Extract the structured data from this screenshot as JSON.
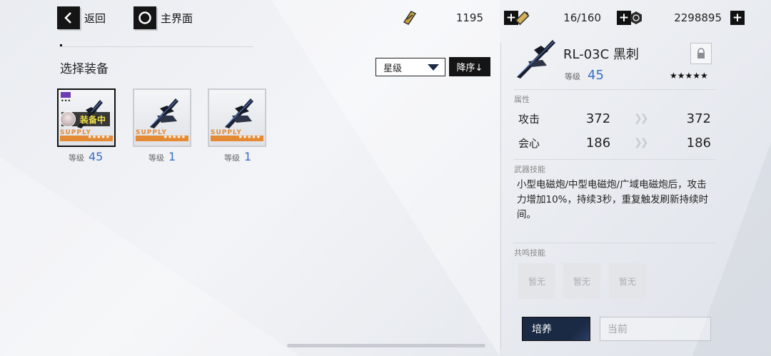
{
  "topbar": {
    "back_label": "返回",
    "home_label": "主界面",
    "resources": [
      {
        "icon": "gold-bar-icon",
        "value": "1195"
      },
      {
        "icon": "battery-icon",
        "value": "16/160"
      },
      {
        "icon": "coin-icon",
        "value": "2298895"
      }
    ],
    "plus_label": "+"
  },
  "left_panel": {
    "title": "选择装备",
    "sort_value": "星级",
    "order_label": "降序↓",
    "level_label": "等级",
    "items": [
      {
        "supply": "SUPPLY",
        "stars": "★★★★★",
        "level": "45",
        "equipped_label": "装备中",
        "selected": true
      },
      {
        "supply": "SUPPLY",
        "stars": "★★★★★",
        "level": "1"
      },
      {
        "supply": "SUPPLY",
        "stars": "★★★★★",
        "level": "1"
      }
    ]
  },
  "detail": {
    "name": "RL-03C 黑刺",
    "level_label": "等级",
    "level": "45",
    "stars": "★★★★★",
    "attributes_title": "属性",
    "stats": [
      {
        "name": "攻击",
        "current": "372",
        "next": "372"
      },
      {
        "name": "会心",
        "current": "186",
        "next": "186"
      }
    ],
    "weapon_skill_title": "武器技能",
    "weapon_skill_desc": "小型电磁炮/中型电磁炮/广域电磁炮后，攻击力增加10%，持续3秒，重复触发刷新持续时间。",
    "resonance_title": "共鸣技能",
    "resonance_slots": [
      "暂无",
      "暂无",
      "暂无"
    ],
    "train_label": "培养",
    "current_placeholder": "当前"
  },
  "colors": {
    "accent_blue": "#3a6ec7",
    "supply_orange": "#e58a34",
    "equipped_yellow": "#f2e14c",
    "train_navy": "#1b2a44"
  }
}
